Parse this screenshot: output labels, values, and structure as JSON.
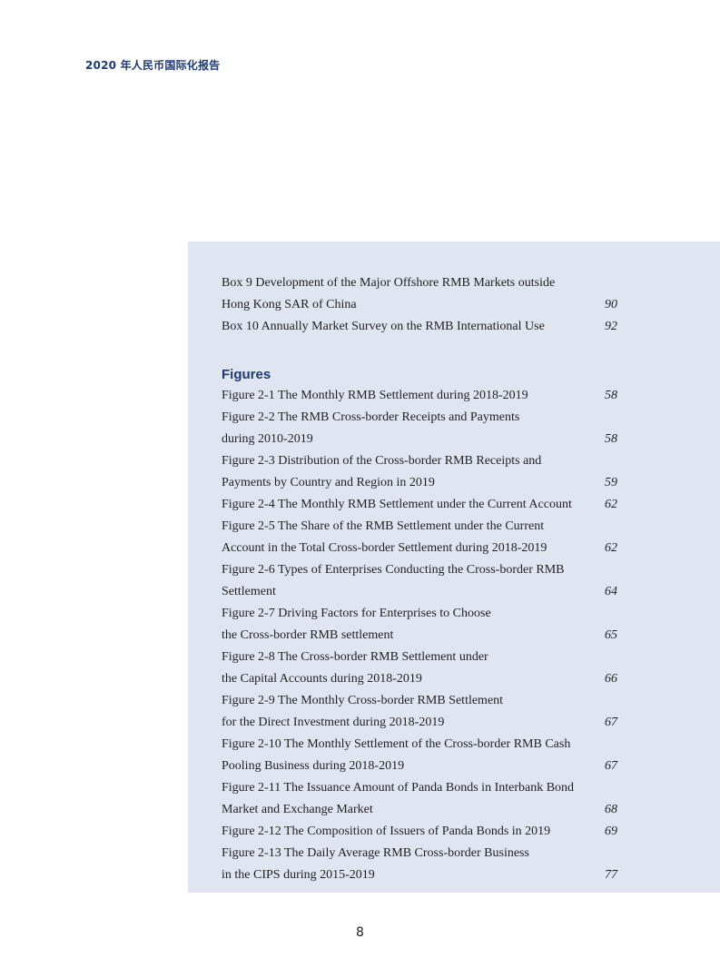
{
  "header": {
    "running_title": "2020 年人民币国际化报告"
  },
  "boxes": [
    {
      "lines": [
        "Box 9  Development of the Major Offshore RMB Markets outside",
        "Hong Kong SAR of China"
      ],
      "page": "90"
    },
    {
      "lines": [
        "Box 10  Annually Market Survey on the RMB International Use"
      ],
      "page": "92"
    }
  ],
  "figures_heading": "Figures",
  "figures": [
    {
      "lines": [
        "Figure 2-1   The Monthly RMB Settlement during 2018-2019"
      ],
      "page": "58"
    },
    {
      "lines": [
        "Figure 2-2  The RMB Cross-border Receipts and Payments",
        "during 2010-2019"
      ],
      "page": "58"
    },
    {
      "lines": [
        "Figure 2-3  Distribution of the Cross-border RMB Receipts and",
        "Payments by Country and Region in 2019"
      ],
      "page": "59"
    },
    {
      "lines": [
        "Figure 2-4  The Monthly RMB Settlement under the Current Account"
      ],
      "page": "62"
    },
    {
      "lines": [
        "Figure 2-5  The Share of the RMB Settlement under the Current",
        "Account in the Total Cross-border Settlement during 2018-2019"
      ],
      "page": "62"
    },
    {
      "lines": [
        "Figure 2-6  Types of Enterprises Conducting the Cross-border RMB",
        "Settlement"
      ],
      "page": "64"
    },
    {
      "lines": [
        "Figure 2-7  Driving Factors for Enterprises to Choose",
        "the Cross-border RMB settlement"
      ],
      "page": "65"
    },
    {
      "lines": [
        "Figure 2-8  The Cross-border RMB Settlement under",
        "the Capital Accounts during 2018-2019"
      ],
      "page": "66"
    },
    {
      "lines": [
        "Figure 2-9  The Monthly Cross-border RMB Settlement",
        "for the Direct Investment during 2018-2019"
      ],
      "page": "67"
    },
    {
      "lines": [
        "Figure 2-10  The Monthly Settlement of the Cross-border RMB Cash",
        "Pooling Business during 2018-2019"
      ],
      "page": "67"
    },
    {
      "lines": [
        "Figure 2-11  The Issuance Amount of Panda Bonds in Interbank Bond",
        "Market and Exchange Market"
      ],
      "page": "68"
    },
    {
      "lines": [
        "Figure 2-12  The Composition of Issuers of Panda Bonds in 2019"
      ],
      "page": "69"
    },
    {
      "lines": [
        "Figure 2-13  The Daily Average RMB Cross-border Business",
        "in the CIPS during 2015-2019"
      ],
      "page": "77"
    }
  ],
  "footer": {
    "page_number": "8"
  },
  "colors": {
    "heading": "#1f3a73",
    "panel_background": "#dfe6f1",
    "text": "#231f20"
  }
}
